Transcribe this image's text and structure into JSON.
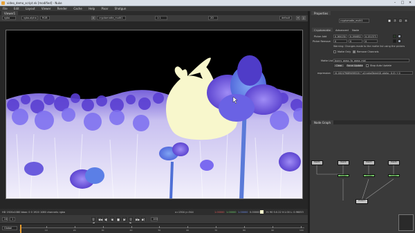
{
  "window": {
    "title": "video_demo_script.nk [modified] - Nuke",
    "min": "–",
    "max": "□",
    "close": "✕"
  },
  "menu": [
    "File",
    "Edit",
    "Layout",
    "Viewer",
    "Render",
    "Cache",
    "Help",
    "Pixar",
    "Shotgun"
  ],
  "viewer": {
    "tab": "Viewer1",
    "channels": "rgba",
    "alpha": "rgba.alpha",
    "rgb_mode": "RGB",
    "node": "cryptomatte_multi1",
    "zoom": "1:1",
    "lut": "default",
    "proxy": "2D",
    "gain_label": "f/8",
    "gamma_label": "Y",
    "info_left": "HD 1920x1080 bbox: 0 0 1920 1080 channels: rgba",
    "info_coords": "x=1304 y=344",
    "info_values": [
      "1.00000",
      "1.00000",
      "1.00000",
      "0.00000"
    ],
    "info_right": "H: 90 S:0.22 V:1.00 L: 0.96053"
  },
  "transport": {
    "fps": "24",
    "frame": "1",
    "in_mode": "Global",
    "frame_end": "100",
    "buttons": [
      "|◀",
      "◀◀",
      "◀|",
      "◀",
      "■",
      "▶",
      "|▶",
      "▶▶",
      "▶|"
    ]
  },
  "timeline": {
    "ticks": [
      "1",
      "10",
      "20",
      "30",
      "40",
      "50",
      "60",
      "70",
      "80",
      "90",
      "100"
    ],
    "current_frame": 1
  },
  "properties": {
    "panel_tab": "Properties",
    "node_name": "cryptomatte_multi1",
    "tabs": [
      "Cryptomatte",
      "Advanced",
      "Node"
    ],
    "picker_add_label": "Picker Add",
    "picker_add_values": [
      "0.164130",
      "0.194652",
      "0.151373"
    ],
    "picker_remove_label": "Picker Remove",
    "picker_remove_values": [
      "0",
      "0",
      "0"
    ],
    "warning": "Warning: Changes made to the matte list using the pickers",
    "matte_only": "Matte Only",
    "remove_channels": "Remove Channels",
    "matte_list_label": "Matte List",
    "matte_list_value": "bunny_grass_fg, grass_mid",
    "clear_btn": "Clear",
    "force_update_btn": "Force Update",
    "stop_auto_update": "Stop Auto Update",
    "expression_label": "expression",
    "expression_value": "(0.162479089498520 ? uCryptoObject01.alpha : 0.0) + 0"
  },
  "nodegraph": {
    "tab": "Node Graph",
    "nodes": [
      {
        "label": "Read1",
        "color": "#b9b9b9"
      },
      {
        "label": "Read2",
        "color": "#b9b9b9"
      },
      {
        "label": "Read3",
        "color": "#b9b9b9"
      },
      {
        "label": "Read4",
        "color": "#b9b9b9"
      },
      {
        "label": "Crypto",
        "color": "#77c96a"
      },
      {
        "label": "Crypto",
        "color": "#77c96a"
      },
      {
        "label": "Crypto",
        "color": "#77c96a"
      },
      {
        "label": "Viewer1",
        "color": "#c9c9c9"
      }
    ]
  },
  "colors": {
    "accent": "#e59a2c",
    "matte": "#f8f7cc",
    "node_green": "#77c96a"
  }
}
